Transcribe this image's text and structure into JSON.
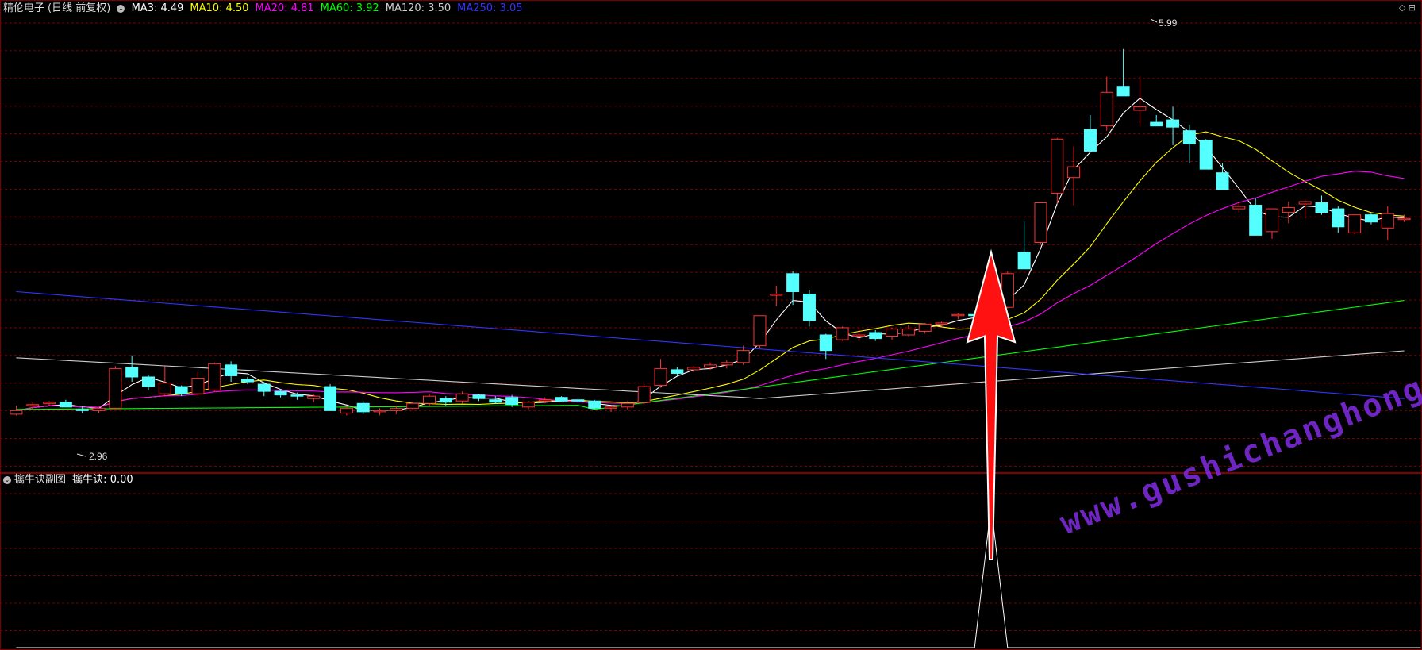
{
  "header": {
    "stock_name": "精伦电子",
    "period": "(日线 前复权)",
    "ma": [
      {
        "label": "MA3:",
        "value": "4.49",
        "color": "#ffffff"
      },
      {
        "label": "MA10:",
        "value": "4.50",
        "color": "#ffff00"
      },
      {
        "label": "MA20:",
        "value": "4.81",
        "color": "#ff00ff"
      },
      {
        "label": "MA60:",
        "value": "3.92",
        "color": "#00ff00"
      },
      {
        "label": "MA120:",
        "value": "3.50",
        "color": "#cccccc"
      },
      {
        "label": "MA250:",
        "value": "3.05",
        "color": "#3333ff"
      }
    ]
  },
  "sub_header": {
    "title": "擒牛诀副图",
    "indicator_label": "擒牛诀:",
    "indicator_value": "0.00"
  },
  "annotations": {
    "high_label": "5.99",
    "low_label": "2.96"
  },
  "watermark": "www.gushichanghong.com",
  "colors": {
    "up": "#ff3333",
    "down": "#54ffff",
    "grid": "#7a0000",
    "arrow": "#ff1111"
  },
  "chart_data": {
    "type": "candlestick",
    "title": "精伦电子 (日线 前复权)",
    "ylim": [
      2.5,
      6.2
    ],
    "candles": [
      [
        2.95,
        3.02,
        2.94,
        2.98
      ],
      [
        3.02,
        3.05,
        2.99,
        3.03
      ],
      [
        3.04,
        3.06,
        3.02,
        3.05
      ],
      [
        3.05,
        3.07,
        3.01,
        3.01
      ],
      [
        2.99,
        3.02,
        2.96,
        2.98
      ],
      [
        2.98,
        3.01,
        2.96,
        3.0
      ],
      [
        3.0,
        3.35,
        2.99,
        3.33
      ],
      [
        3.34,
        3.44,
        3.22,
        3.26
      ],
      [
        3.26,
        3.28,
        3.15,
        3.18
      ],
      [
        3.12,
        3.35,
        3.1,
        3.21
      ],
      [
        3.18,
        3.19,
        3.1,
        3.12
      ],
      [
        3.12,
        3.3,
        3.1,
        3.25
      ],
      [
        3.15,
        3.38,
        3.14,
        3.37
      ],
      [
        3.36,
        3.39,
        3.22,
        3.27
      ],
      [
        3.24,
        3.26,
        3.2,
        3.22
      ],
      [
        3.2,
        3.22,
        3.1,
        3.14
      ],
      [
        3.14,
        3.16,
        3.09,
        3.11
      ],
      [
        3.11,
        3.13,
        3.07,
        3.1
      ],
      [
        3.08,
        3.12,
        3.05,
        3.1
      ],
      [
        3.18,
        3.2,
        2.98,
        2.98
      ],
      [
        2.96,
        3.02,
        2.94,
        3.0
      ],
      [
        3.04,
        3.06,
        2.95,
        2.97
      ],
      [
        2.97,
        3.0,
        2.94,
        2.98
      ],
      [
        2.98,
        3.02,
        2.95,
        3.0
      ],
      [
        3.0,
        3.05,
        2.98,
        3.04
      ],
      [
        3.04,
        3.12,
        3.02,
        3.1
      ],
      [
        3.08,
        3.1,
        3.02,
        3.05
      ],
      [
        3.06,
        3.14,
        3.04,
        3.12
      ],
      [
        3.11,
        3.12,
        3.06,
        3.08
      ],
      [
        3.07,
        3.1,
        3.04,
        3.05
      ],
      [
        3.09,
        3.11,
        3.01,
        3.03
      ],
      [
        3.01,
        3.06,
        2.99,
        3.05
      ],
      [
        3.06,
        3.09,
        3.04,
        3.07
      ],
      [
        3.09,
        3.1,
        3.05,
        3.06
      ],
      [
        3.07,
        3.09,
        3.04,
        3.06
      ],
      [
        3.06,
        3.07,
        2.99,
        3.0
      ],
      [
        3.0,
        3.02,
        2.97,
        3.01
      ],
      [
        3.01,
        3.06,
        2.99,
        3.04
      ],
      [
        3.05,
        3.2,
        3.03,
        3.18
      ],
      [
        3.19,
        3.41,
        3.17,
        3.33
      ],
      [
        3.32,
        3.34,
        3.27,
        3.29
      ],
      [
        3.32,
        3.35,
        3.3,
        3.34
      ],
      [
        3.34,
        3.38,
        3.32,
        3.36
      ],
      [
        3.36,
        3.4,
        3.33,
        3.38
      ],
      [
        3.38,
        3.52,
        3.36,
        3.48
      ],
      [
        3.52,
        3.63,
        3.5,
        3.77
      ],
      [
        3.95,
        4.02,
        3.85,
        3.95
      ],
      [
        4.12,
        4.14,
        3.86,
        3.97
      ],
      [
        3.95,
        3.98,
        3.68,
        3.73
      ],
      [
        3.61,
        3.62,
        3.41,
        3.48
      ],
      [
        3.57,
        3.68,
        3.56,
        3.67
      ],
      [
        3.6,
        3.67,
        3.56,
        3.61
      ],
      [
        3.63,
        3.65,
        3.56,
        3.58
      ],
      [
        3.6,
        3.67,
        3.57,
        3.66
      ],
      [
        3.61,
        3.69,
        3.6,
        3.66
      ],
      [
        3.64,
        3.71,
        3.62,
        3.7
      ],
      [
        3.7,
        3.72,
        3.68,
        3.71
      ],
      [
        3.77,
        3.79,
        3.74,
        3.78
      ],
      [
        3.78,
        3.8,
        3.76,
        3.77
      ],
      [
        3.77,
        3.82,
        3.76,
        3.8
      ],
      [
        3.84,
        4.14,
        3.83,
        4.12
      ],
      [
        4.3,
        4.55,
        4.29,
        4.16
      ],
      [
        4.38,
        4.64,
        4.36,
        4.71
      ],
      [
        4.79,
        5.25,
        4.7,
        5.24
      ],
      [
        4.92,
        5.18,
        4.69,
        5.01
      ],
      [
        5.32,
        5.44,
        5.2,
        5.14
      ],
      [
        5.35,
        5.76,
        5.31,
        5.63
      ],
      [
        5.68,
        5.99,
        5.64,
        5.6
      ],
      [
        5.48,
        5.76,
        5.35,
        5.51
      ],
      [
        5.38,
        5.44,
        5.36,
        5.35
      ],
      [
        5.4,
        5.51,
        5.19,
        5.34
      ],
      [
        5.31,
        5.36,
        5.04,
        5.2
      ],
      [
        5.23,
        5.24,
        5.0,
        4.99
      ],
      [
        4.96,
        5.04,
        4.95,
        4.82
      ],
      [
        4.66,
        4.71,
        4.63,
        4.68
      ],
      [
        4.69,
        4.75,
        4.5,
        4.44
      ],
      [
        4.47,
        4.55,
        4.41,
        4.66
      ],
      [
        4.63,
        4.72,
        4.54,
        4.67
      ],
      [
        4.7,
        4.74,
        4.58,
        4.72
      ],
      [
        4.71,
        4.77,
        4.61,
        4.63
      ],
      [
        4.66,
        4.68,
        4.46,
        4.51
      ],
      [
        4.46,
        4.61,
        4.45,
        4.61
      ],
      [
        4.61,
        4.62,
        4.53,
        4.55
      ],
      [
        4.5,
        4.68,
        4.4,
        4.62
      ],
      [
        4.58,
        4.61,
        4.55,
        4.58
      ]
    ],
    "indicator_series": {
      "name": "擒牛诀",
      "values": [
        0,
        0,
        0,
        0,
        0,
        0,
        0,
        0,
        0,
        0,
        0,
        0,
        0,
        0,
        0,
        0,
        0,
        0,
        0,
        0,
        0,
        0,
        0,
        0,
        0,
        0,
        0,
        0,
        0,
        0,
        0,
        0,
        0,
        0,
        0,
        0,
        0,
        0,
        0,
        0,
        0,
        0,
        0,
        0,
        0,
        0,
        0,
        0,
        0,
        0,
        0,
        0,
        0,
        0,
        0,
        0,
        0,
        0,
        0,
        1,
        0,
        0,
        0,
        0,
        0,
        0,
        0,
        0,
        0,
        0,
        0,
        0,
        0,
        0,
        0,
        0,
        0,
        0,
        0,
        0,
        0,
        0,
        0,
        0,
        0,
        0
      ]
    }
  }
}
